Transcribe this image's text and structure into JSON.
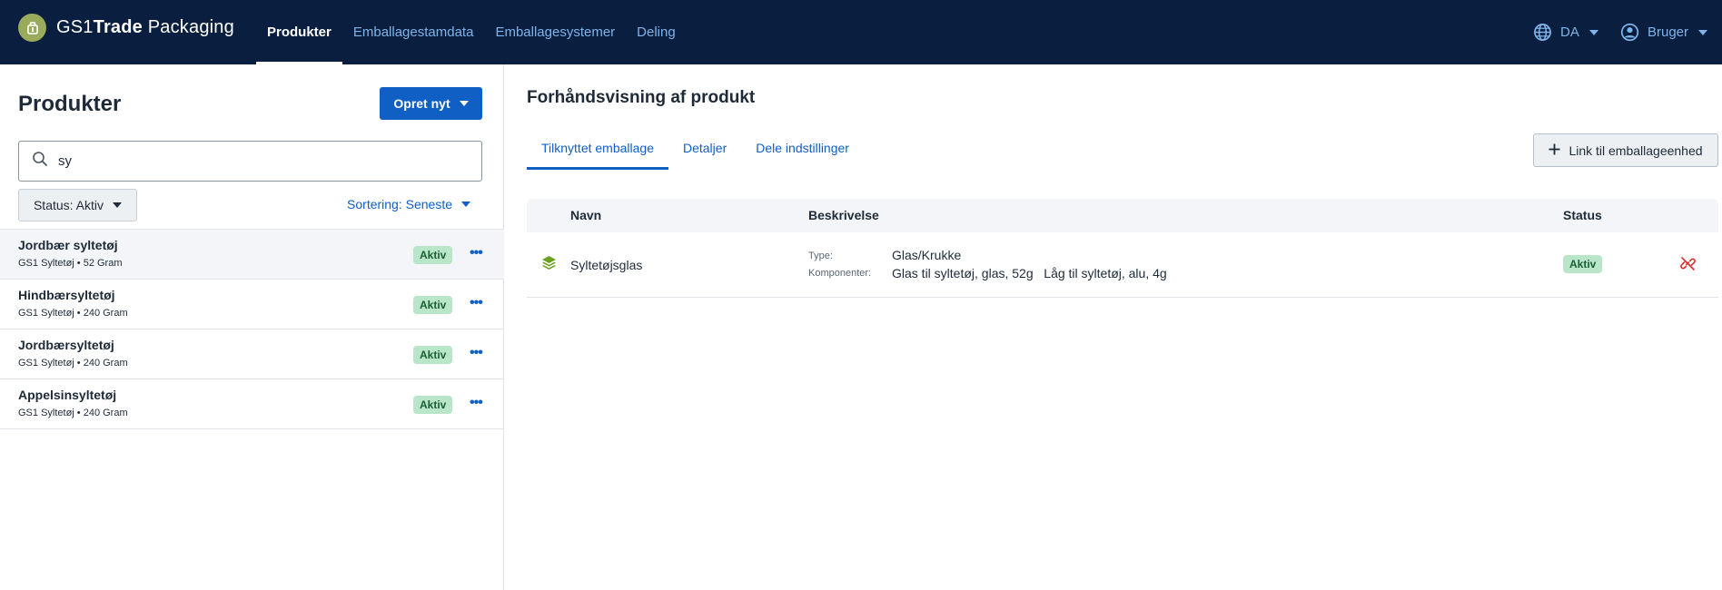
{
  "colors": {
    "nav_bg": "#0a1f3f",
    "primary": "#0f5fc4",
    "badge_bg": "#b9e6c9",
    "danger": "#d32f2f",
    "logo_green": "#9aac5b"
  },
  "header": {
    "logo": {
      "prefix": "GS1",
      "bold": "Trade",
      "suffix": " Packaging"
    },
    "nav": [
      {
        "label": "Produkter",
        "active": true
      },
      {
        "label": "Emballagestamdata"
      },
      {
        "label": "Emballagesystemer"
      },
      {
        "label": "Deling"
      }
    ],
    "language": {
      "icon": "globe-icon",
      "label": "DA"
    },
    "user": {
      "icon": "user-icon",
      "label": "Bruger"
    }
  },
  "products_panel": {
    "title": "Produkter",
    "create_button": "Opret nyt",
    "search": {
      "icon": "search-icon",
      "value": "sy"
    },
    "status_filter": "Status: Aktiv",
    "sort": "Sortering: Seneste",
    "items": [
      {
        "name": "Jordbær syltetøj",
        "sub": "GS1 Syltetøj • 52 Gram",
        "status": "Aktiv",
        "selected": true
      },
      {
        "name": "Hindbærsyltetøj",
        "sub": "GS1 Syltetøj • 240 Gram",
        "status": "Aktiv"
      },
      {
        "name": "Jordbærsyltetøj",
        "sub": "GS1 Syltetøj • 240 Gram",
        "status": "Aktiv"
      },
      {
        "name": "Appelsinsyltetøj",
        "sub": "GS1 Syltetøj • 240 Gram",
        "status": "Aktiv"
      }
    ],
    "more_icon": "more-horizontal-icon"
  },
  "preview": {
    "title": "Forhåndsvisning af produkt",
    "tabs": [
      {
        "label": "Tilknyttet emballage",
        "active": true
      },
      {
        "label": "Detaljer"
      },
      {
        "label": "Dele indstillinger"
      }
    ],
    "link_button": {
      "icon": "plus-icon",
      "label": "Link til emballageenhed"
    },
    "table": {
      "headers": {
        "name": "Navn",
        "description": "Beskrivelse",
        "status": "Status"
      },
      "rows": [
        {
          "icon": "layers-icon",
          "name": "Syltetøjsglas",
          "type_label": "Type:",
          "type_value": "Glas/Krukke",
          "components_label": "Komponenter:",
          "components_value": "Glas til syltetøj, glas, 52g   Låg til syltetøj, alu, 4g",
          "status": "Aktiv",
          "action_icon": "unlink-icon"
        }
      ]
    }
  }
}
